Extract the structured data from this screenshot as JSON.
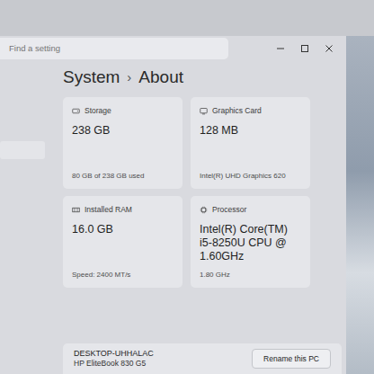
{
  "search": {
    "placeholder": "Find a setting"
  },
  "breadcrumb": {
    "parent": "System",
    "separator": "›",
    "current": "About"
  },
  "specs": [
    {
      "kind": "storage",
      "label": "Storage",
      "value": "238 GB",
      "detail": "80 GB of 238 GB used"
    },
    {
      "kind": "graphics",
      "label": "Graphics Card",
      "value": "128 MB",
      "detail": "Intel(R) UHD Graphics 620"
    },
    {
      "kind": "ram",
      "label": "Installed RAM",
      "value": "16.0 GB",
      "detail": "Speed: 2400 MT/s"
    },
    {
      "kind": "processor",
      "label": "Processor",
      "value": "Intel(R) Core(TM) i5-8250U CPU @ 1.60GHz",
      "detail": "1.80 GHz"
    }
  ],
  "device": {
    "name": "DESKTOP-UHHALAC",
    "model": "HP EliteBook 830 G5"
  },
  "buttons": [
    "Rename this PC"
  ]
}
